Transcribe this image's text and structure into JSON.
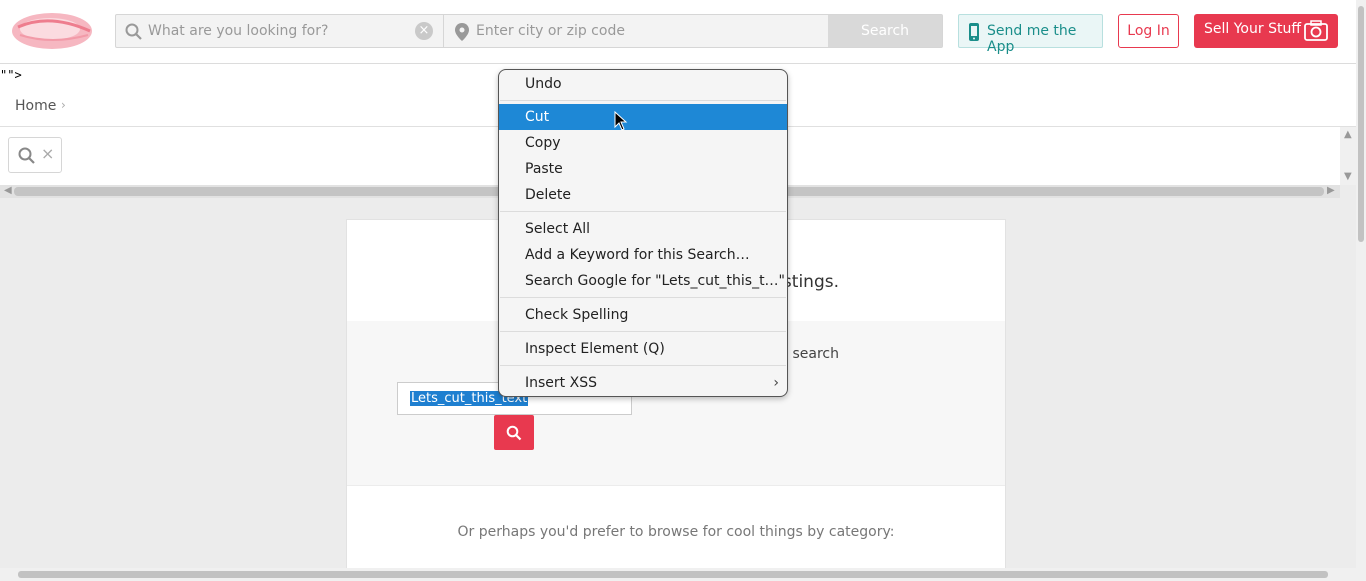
{
  "header": {
    "search_placeholder": "What are you looking for?",
    "location_placeholder": "Enter city or zip code",
    "search_label": "Search",
    "send_app_label": "Send me the App",
    "login_label": "Log In",
    "sell_label": "Sell Your Stuff"
  },
  "stray_text": "\"\">",
  "breadcrumb": {
    "home": "Home",
    "separator": "›"
  },
  "card": {
    "message_fragment": "stings.",
    "hint_fragment": "er search",
    "input_value": "Lets_cut_this_text",
    "browse_text": "Or perhaps you'd prefer to browse for cool things by category:"
  },
  "context_menu": {
    "items": [
      {
        "label": "Undo"
      },
      {
        "label": "Cut",
        "highlighted": true
      },
      {
        "label": "Copy"
      },
      {
        "label": "Paste"
      },
      {
        "label": "Delete"
      },
      {
        "label": "Select All"
      },
      {
        "label": "Add a Keyword for this Search…"
      },
      {
        "label": "Search Google for \"Lets_cut_this_t…\""
      },
      {
        "label": "Check Spelling"
      },
      {
        "label": "Inspect Element (Q)"
      },
      {
        "label": "Insert XSS",
        "submenu": true
      }
    ]
  },
  "colors": {
    "brand": "#e8394f",
    "highlight": "#1e88d6",
    "app_teal": "#1a8e8a"
  },
  "icons": [
    "logo-icon",
    "search-icon",
    "clear-icon",
    "location-pin-icon",
    "phone-icon",
    "camera-icon",
    "close-icon",
    "chevron-right-icon",
    "cursor-icon"
  ]
}
